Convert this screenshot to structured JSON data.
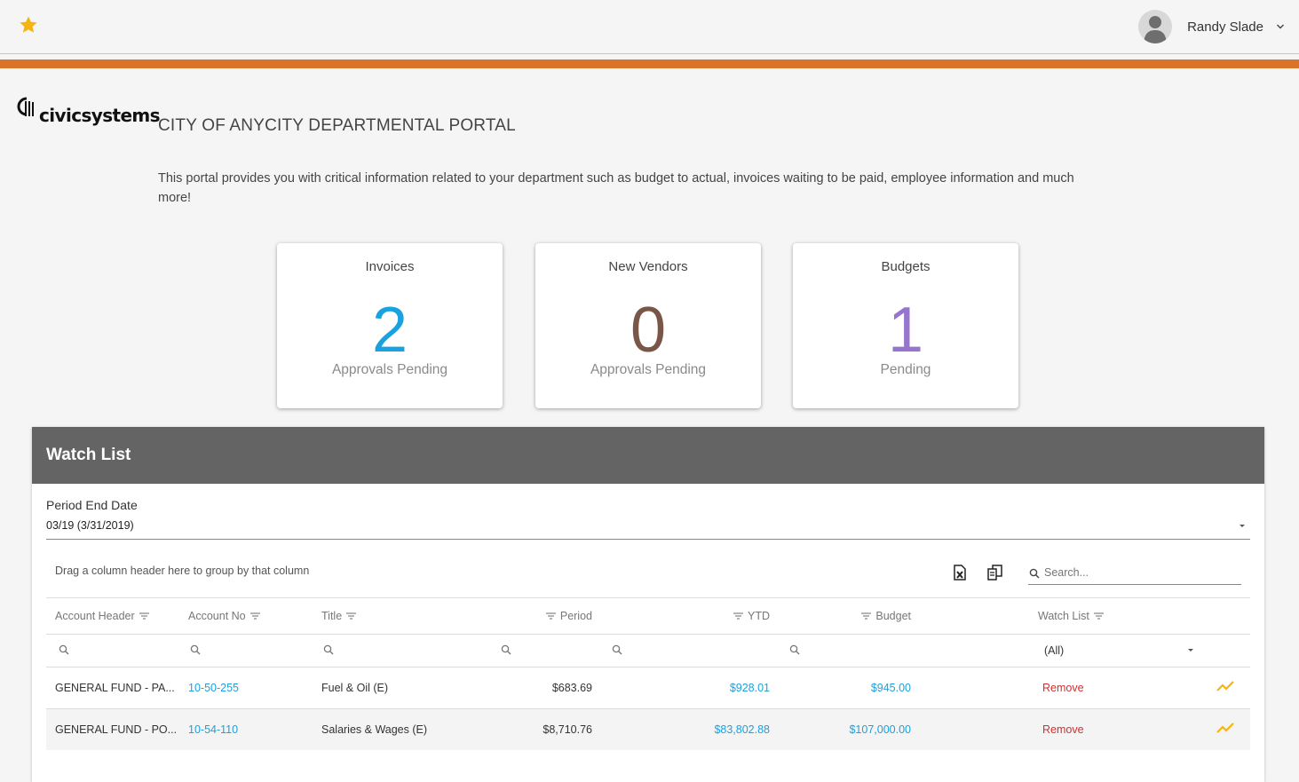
{
  "header": {
    "user_name": "Randy Slade",
    "favorite_icon": "star-icon",
    "accent_color": "#d9742a"
  },
  "brand": {
    "logo_text": "civicsystems",
    "portal_title": "CITY OF ANYCITY DEPARTMENTAL PORTAL",
    "intro": "This portal provides you with critical information related to your department such as budget to actual, invoices waiting to be paid, employee information and much more!"
  },
  "cards": [
    {
      "title": "Invoices",
      "value": "2",
      "subtitle": "Approvals Pending",
      "color": "#1aa1e0"
    },
    {
      "title": "New Vendors",
      "value": "0",
      "subtitle": "Approvals Pending",
      "color": "#7a5648"
    },
    {
      "title": "Budgets",
      "value": "1",
      "subtitle": "Pending",
      "color": "#9575cd"
    }
  ],
  "watchlist": {
    "title": "Watch List",
    "period_label": "Period End Date",
    "period_value": "03/19 (3/31/2019)",
    "group_hint": "Drag a column header here to group by that column",
    "search_placeholder": "Search...",
    "columns": [
      "Account Header",
      "Account No",
      "Title",
      "Period",
      "YTD",
      "Budget",
      "Watch List"
    ],
    "watch_filter": "(All)",
    "rows": [
      {
        "account_header": "GENERAL FUND - PA...",
        "account_no": "10-50-255",
        "title": "Fuel & Oil (E)",
        "period": "$683.69",
        "ytd": "$928.01",
        "budget": "$945.00",
        "action": "Remove"
      },
      {
        "account_header": "GENERAL FUND - PO...",
        "account_no": "10-54-110",
        "title": "Salaries & Wages (E)",
        "period": "$8,710.76",
        "ytd": "$83,802.88",
        "budget": "$107,000.00",
        "action": "Remove"
      }
    ]
  }
}
